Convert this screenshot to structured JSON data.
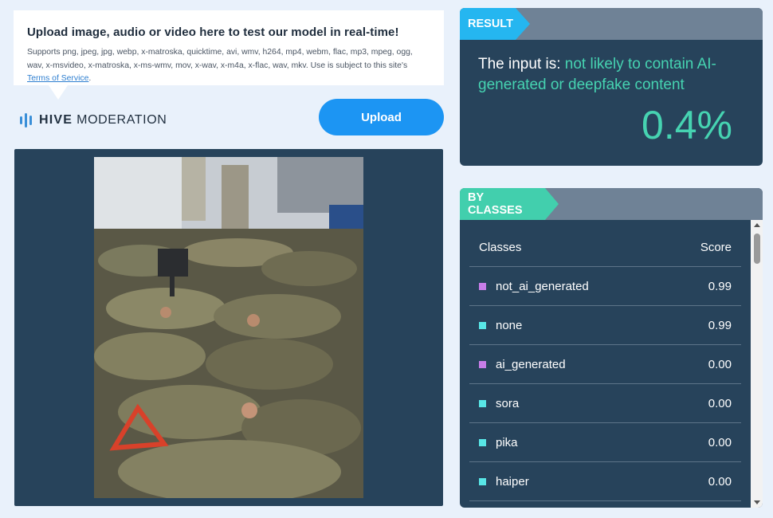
{
  "upload_info": {
    "title": "Upload image, audio or video here to test our model in real-time!",
    "supports_text": "Supports png, jpeg, jpg, webp, x-matroska, quicktime, avi, wmv, h264, mp4, webm, flac, mp3, mpeg, ogg, wav, x-msvideo, x-matroska, x-ms-wmv, mov, x-wav, x-m4a, x-flac, wav, mkv. Use is subject to this site's ",
    "terms_link": "Terms of Service",
    "terms_suffix": "."
  },
  "logo": {
    "brand": "HIVE",
    "product": "MODERATION",
    "icon": "hive-logo-icon"
  },
  "upload_button": {
    "label": "Upload"
  },
  "result": {
    "tag": "RESULT",
    "prefix": "The input is: ",
    "verdict": "not likely to contain AI-generated or deepfake content",
    "score": "0.4%"
  },
  "classes": {
    "tag": "BY CLASSES",
    "header": {
      "classes": "Classes",
      "score": "Score"
    },
    "rows": [
      {
        "name": "not_ai_generated",
        "score": "0.99",
        "color": "#c77de8"
      },
      {
        "name": "none",
        "score": "0.99",
        "color": "#58e6e6"
      },
      {
        "name": "ai_generated",
        "score": "0.00",
        "color": "#c77de8"
      },
      {
        "name": "sora",
        "score": "0.00",
        "color": "#58e6e6"
      },
      {
        "name": "pika",
        "score": "0.00",
        "color": "#58e6e6"
      },
      {
        "name": "haiper",
        "score": "0.00",
        "color": "#58e6e6"
      }
    ]
  },
  "colors": {
    "accent_blue": "#1c95f3",
    "result_green": "#46d3b1",
    "panel_navy": "#27435b"
  }
}
